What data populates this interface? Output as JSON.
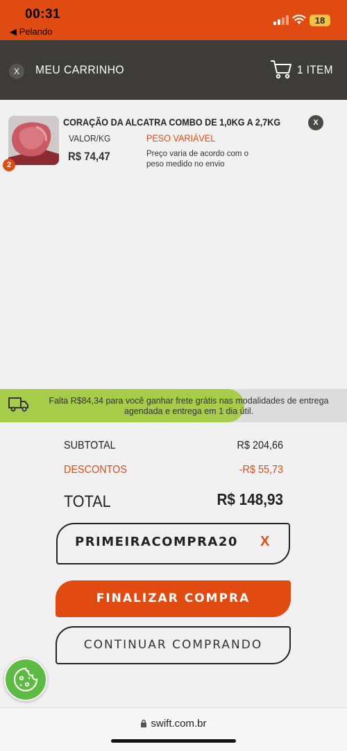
{
  "status_bar": {
    "time": "00:31",
    "back_label": "◀ Pelando",
    "battery": "18"
  },
  "header": {
    "close_label": "X",
    "title": "MEU CARRINHO",
    "cart_count": "1 ITEM"
  },
  "cart_item": {
    "quantity": "2",
    "name": "CORAÇÃO DA ALCATRA COMBO DE 1,0KG A 2,7KG",
    "remove_label": "X",
    "valor_label": "VALOR/KG",
    "price": "R$ 74,47",
    "peso_label": "PESO VARIÁVEL",
    "peso_note": "Preço varia de acordo com o peso medido no envio"
  },
  "shipping_banner": {
    "text": "Falta R$84,34 para você ganhar frete grátis nas modalidades de entrega agendada e entrega em 1 dia útil."
  },
  "summary": {
    "subtotal_label": "SUBTOTAL",
    "subtotal_value": "R$ 204,66",
    "discount_label": "DESCONTOS",
    "discount_value": "-R$ 55,73",
    "total_label": "TOTAL",
    "total_value": "R$ 148,93"
  },
  "coupon": {
    "code": "PRIMEIRACOMPRA20",
    "remove_label": "X"
  },
  "buttons": {
    "checkout": "FINALIZAR COMPRA",
    "continue": "CONTINUAR COMPRANDO"
  },
  "browser": {
    "url": "swift.com.br"
  },
  "colors": {
    "accent": "#e04b12",
    "header_bg": "#3d3c38",
    "banner_green": "#a7cc4a"
  }
}
